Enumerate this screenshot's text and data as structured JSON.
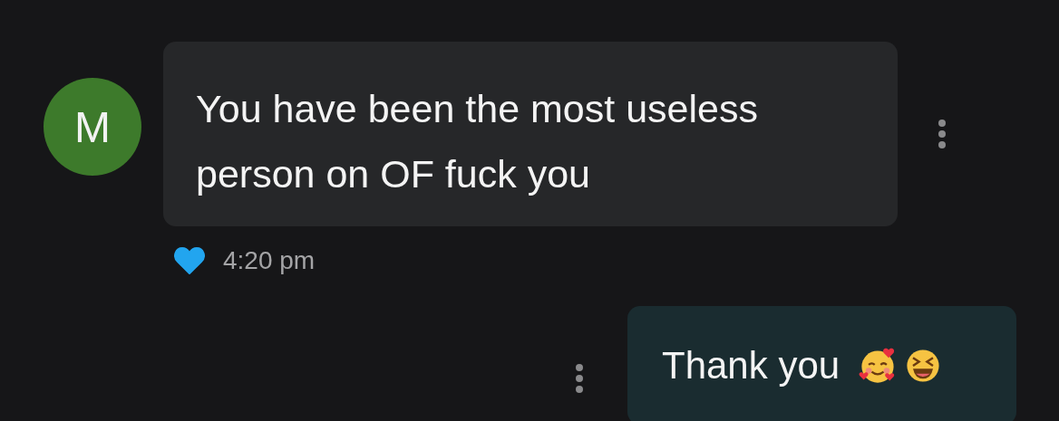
{
  "messages": [
    {
      "kind": "incoming",
      "avatar": "M",
      "text": "You have been the most useless person on OF fuck you",
      "liked": true,
      "time": "4:20 pm"
    },
    {
      "kind": "outgoing",
      "text": "Thank you",
      "emojis": [
        {
          "kind": "hearts"
        },
        {
          "kind": "squint"
        }
      ]
    }
  ]
}
